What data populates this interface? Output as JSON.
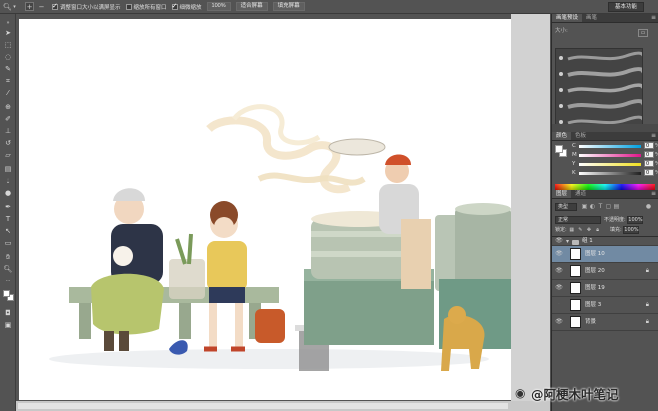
{
  "options_bar": {
    "checkbox_resize_windows": "调整窗口大小以满屏显示",
    "checkbox_zoom_all": "缩放所有窗口",
    "checkbox_scrubby_zoom": "细微缩放",
    "btn_100": "100%",
    "btn_fit_screen": "适合屏幕",
    "btn_fill_screen": "填充屏幕",
    "workspace": "基本功能"
  },
  "brush_panel": {
    "tabs": [
      "画笔预设",
      "画笔"
    ],
    "size_label": "大小:"
  },
  "color_panel": {
    "tabs": [
      "颜色",
      "色板"
    ],
    "channels": [
      {
        "label": "C",
        "value": "0",
        "unit": "%",
        "color": "#00a0e0"
      },
      {
        "label": "M",
        "value": "0",
        "unit": "%",
        "color": "#e0158a"
      },
      {
        "label": "Y",
        "value": "0",
        "unit": "%",
        "color": "#f0e020"
      },
      {
        "label": "K",
        "value": "0",
        "unit": "%",
        "color": "#202020"
      }
    ]
  },
  "layers_panel": {
    "tabs": [
      "图层",
      "通道"
    ],
    "filter_kind": "类型",
    "blend_mode": "正常",
    "opacity_label": "不透明度:",
    "opacity_value": "100%",
    "lock_label": "锁定:",
    "fill_label": "填充:",
    "fill_value": "100%",
    "layers": [
      {
        "name": "组 1",
        "type": "group",
        "visible": true,
        "locked": false,
        "selected": false
      },
      {
        "name": "图层 10",
        "type": "layer",
        "visible": true,
        "locked": false,
        "selected": true
      },
      {
        "name": "图层 20",
        "type": "layer",
        "visible": true,
        "locked": true,
        "selected": false
      },
      {
        "name": "图层 19",
        "type": "layer",
        "visible": true,
        "locked": false,
        "selected": false
      },
      {
        "name": "图层 3",
        "type": "layer",
        "visible": false,
        "locked": true,
        "selected": false
      },
      {
        "name": "背景",
        "type": "background",
        "visible": true,
        "locked": true,
        "selected": false
      }
    ]
  },
  "tools": [
    "zoom-tool",
    "move-tool",
    "marquee-tool",
    "lasso-tool",
    "quick-select-tool",
    "crop-tool",
    "eyedropper-tool",
    "healing-tool",
    "brush-tool",
    "clone-stamp-tool",
    "history-brush-tool",
    "eraser-tool",
    "gradient-tool",
    "blur-tool",
    "dodge-tool",
    "pen-tool",
    "type-tool",
    "path-select-tool",
    "shape-tool",
    "hand-tool",
    "zoom-tool-2"
  ],
  "watermark": "@阿梗木叶笔记",
  "colors": {
    "ui_bg": "#535353",
    "panel_dark": "#3c3c3c",
    "selected_layer": "#718aa3"
  }
}
